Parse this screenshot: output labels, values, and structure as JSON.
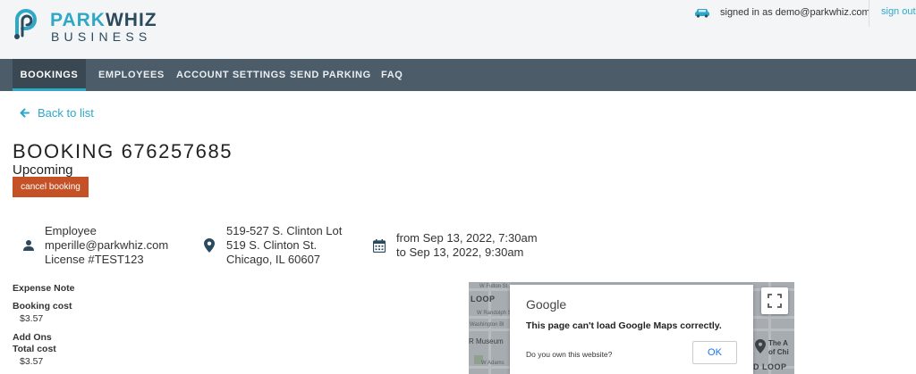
{
  "header": {
    "logo_primary_a": "PARK",
    "logo_primary_b": "WHIZ",
    "logo_secondary": "BUSINESS",
    "signed_in_text": "signed in as demo@parkwhiz.com",
    "signout_label": "sign out"
  },
  "nav": {
    "items": [
      {
        "label": "BOOKINGS"
      },
      {
        "label": "EMPLOYEES"
      },
      {
        "label": "ACCOUNT SETTINGS"
      },
      {
        "label": "SEND PARKING"
      },
      {
        "label": "FAQ"
      }
    ],
    "active": "BOOKINGS"
  },
  "back_label": "Back to list",
  "booking": {
    "title": "BOOKING 676257685",
    "status": "Upcoming",
    "cancel_label": "cancel booking",
    "employee": {
      "label": "Employee",
      "email": "mperille@parkwhiz.com",
      "license": "License #TEST123"
    },
    "location": {
      "name": "519-527 S. Clinton Lot",
      "street": "519 S. Clinton St.",
      "city": "Chicago, IL 60607"
    },
    "time": {
      "from": "from Sep 13, 2022, 7:30am",
      "to": "to Sep 13, 2022, 9:30am"
    }
  },
  "costs": {
    "expense_note_label": "Expense Note",
    "booking_cost_label": "Booking cost",
    "booking_cost_value": "$3.57",
    "add_ons_label": "Add Ons",
    "total_cost_label": "Total cost",
    "total_cost_value": "$3.57"
  },
  "map": {
    "streets": [
      "W Fulton St",
      "W Randolph St",
      "Washington Bl",
      "W Adams"
    ],
    "labels": [
      "LOOP",
      "R Museum",
      "The A",
      "of Chi",
      "D LOOP"
    ],
    "dialog": {
      "logo": "Google",
      "message": "This page can't load Google Maps correctly.",
      "question": "Do you own this website?",
      "ok_label": "OK"
    }
  },
  "colors": {
    "brand_blue": "#2fa8c8",
    "nav_bg": "#4c5c69",
    "cancel_bg": "#c45226"
  }
}
